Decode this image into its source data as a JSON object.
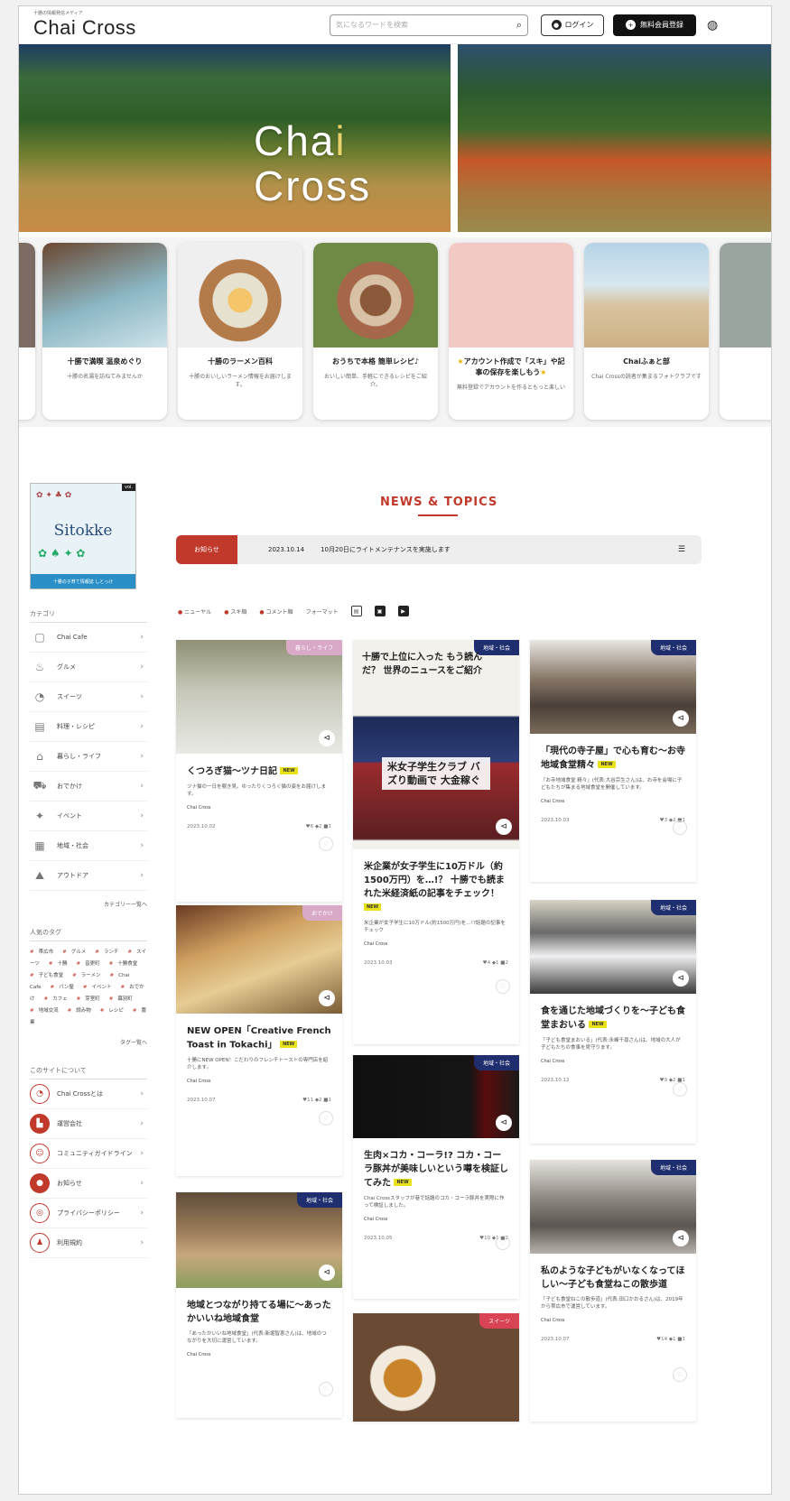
{
  "header": {
    "logo_small": "十勝の情報発信メディア",
    "logo": "Chai Cross",
    "search_placeholder": "気になるワードを検索",
    "login_label": "ログイン",
    "register_label": "無料会員登録"
  },
  "hero": {
    "title_1a": "Cha",
    "title_1b": "i",
    "title_2": "Cross"
  },
  "carousel": [
    {
      "title": "十勝で満喫 温泉めぐり",
      "desc": "十勝の名湯を訪ねてみませんか"
    },
    {
      "title": "十勝のラーメン百科",
      "desc": "十勝のおいしいラーメン情報をお届けします。"
    },
    {
      "title": "おうちで本格 簡単レシピ♪",
      "desc": "おいしい簡単、手軽にできるレシピをご紹介。"
    },
    {
      "title": "アカウント作成で「スキ」や記事の保存を楽しもう",
      "desc": "無料登録でアカウントを作るともっと楽しい"
    },
    {
      "title": "Chaiふぁと部",
      "desc": "Chai Crossの読者が集まるフォトクラブです"
    }
  ],
  "magazine": {
    "title": "Sitokke",
    "band": "十勝の子育て情報誌 しとっけ",
    "num": "vol."
  },
  "sidebar": {
    "category_heading": "カテゴリ",
    "categories": [
      "Chai Cafe",
      "グルメ",
      "スイーツ",
      "料理・レシピ",
      "暮らし・ライフ",
      "おでかけ",
      "イベント",
      "地域・社会",
      "アウトドア"
    ],
    "more_label": "カテゴリー一覧へ",
    "tags_heading": "人気のタグ",
    "tags": [
      "帯広市",
      "グルメ",
      "ランチ",
      "スイーツ",
      "十勝",
      "音更町",
      "十勝食堂",
      "子ども食堂",
      "ラーメン",
      "Chai Cafe",
      "パン屋",
      "イベント",
      "おでかけ",
      "カフェ",
      "芽室町",
      "幕別町",
      "地域交流",
      "読み物",
      "レシピ",
      "農業"
    ],
    "tags_more": "タグ一覧へ",
    "about_heading": "このサイトについて",
    "about": [
      "Chai Crossとは",
      "運営会社",
      "コミュニティガイドライン",
      "お知らせ",
      "プライバシーポリシー",
      "利用規約"
    ]
  },
  "news": {
    "heading": "NEWS & TOPICS",
    "tag": "お知らせ",
    "date": "2023.10.14",
    "text": "10月20日にライトメンテナンスを実施します",
    "menu_icon": "list-icon"
  },
  "filters": {
    "f1": "ニューヤル",
    "f2": "スキ順",
    "f3": "コメント順",
    "format_label": "フォーマット"
  },
  "articles": [
    {
      "badge": "暮らし・ライフ",
      "title": "くつろぎ猫〜ツナ日記",
      "desc": "ツナ猫の一日を覗き見。ゆったりくつろぐ猫の姿をお届けします。",
      "author": "Chai Cross",
      "date": "2023.10.02",
      "stats": "♥6 ◆2 ■1"
    },
    {
      "badge": "地域・社会",
      "title": "十勝で上位に入った もう読んだ？ 世界のニュースをご紹介",
      "subtitle": "米女子学生クラブ バズり動画で 大金稼ぐ",
      "desc": "米企業が女子学生に10万ドル(約1500万円)を…!?話題の記事をチェック",
      "author": "Chai Cross",
      "date": "2023.10.03",
      "stats": "♥4 ◆1 ■2",
      "body_title": "米企業が女子学生に10万ドル（約1500万円）を…!？ 十勝でも読まれた米経済紙の記事をチェック！"
    },
    {
      "badge": "地域・社会",
      "title": "「現代の寺子屋」で心も育む〜お寺地域食堂精々",
      "desc": "「お寺地域食堂 精々」(代表:大谷宗生さん)は、お寺を会場に子どもたちが集まる地域食堂を開催しています。",
      "author": "Chai Cross",
      "date": "2023.10.03",
      "stats": "♥3 ◆2 ■1"
    },
    {
      "badge": "おでかけ",
      "title": "NEW OPEN「Creative French Toast in Tokachi」",
      "desc": "十勝にNEW OPEN！こだわりのフレンチトーストの専門店を紹介します。",
      "author": "Chai Cross",
      "date": "2023.10.07",
      "stats": "♥11 ◆2 ■1"
    },
    {
      "badge": "地域・社会",
      "title": "食を通じた地域づくりを〜子ども食堂まおいる",
      "desc": "「子ども食堂まおいる」(代表:永峰千尋さん)は、地域の大人が子どもたちの食事を見守ります。",
      "author": "Chai Cross",
      "date": "2023.10.12",
      "stats": "♥9 ◆2 ■1"
    },
    {
      "badge": "地域・社会",
      "title": "生肉×コカ・コーラ!? コカ・コーラ豚丼が美味しいという噂を検証してみた",
      "desc": "Chai Crossスタッフが巷で話題のコカ・コーラ豚丼を実際に作って検証しました。",
      "author": "Chai Cross",
      "date": "2023.10.05",
      "stats": "♥10 ◆1 ■2"
    },
    {
      "badge": "地域・社会",
      "title": "地域とつながり持てる場に〜あったかいいね地域食堂",
      "desc": "「あったかいいね地域食堂」(代表:新堀智恵さん)は、地域のつながりを大切に運営しています。",
      "author": "Chai Cross",
      "date": "",
      "stats": ""
    },
    {
      "badge": "スイーツ",
      "title": "",
      "desc": "",
      "author": "",
      "date": "",
      "stats": ""
    },
    {
      "badge": "地域・社会",
      "title": "私のような子どもがいなくなってほしい〜子ども食堂ねこの散歩道",
      "desc": "「子ども食堂ねこの散歩道」(代表:田口かおるさん)は、2019年から帯広市で運営しています。",
      "author": "Chai Cross",
      "date": "2023.10.07",
      "stats": "♥14 ◆1 ■1"
    }
  ]
}
